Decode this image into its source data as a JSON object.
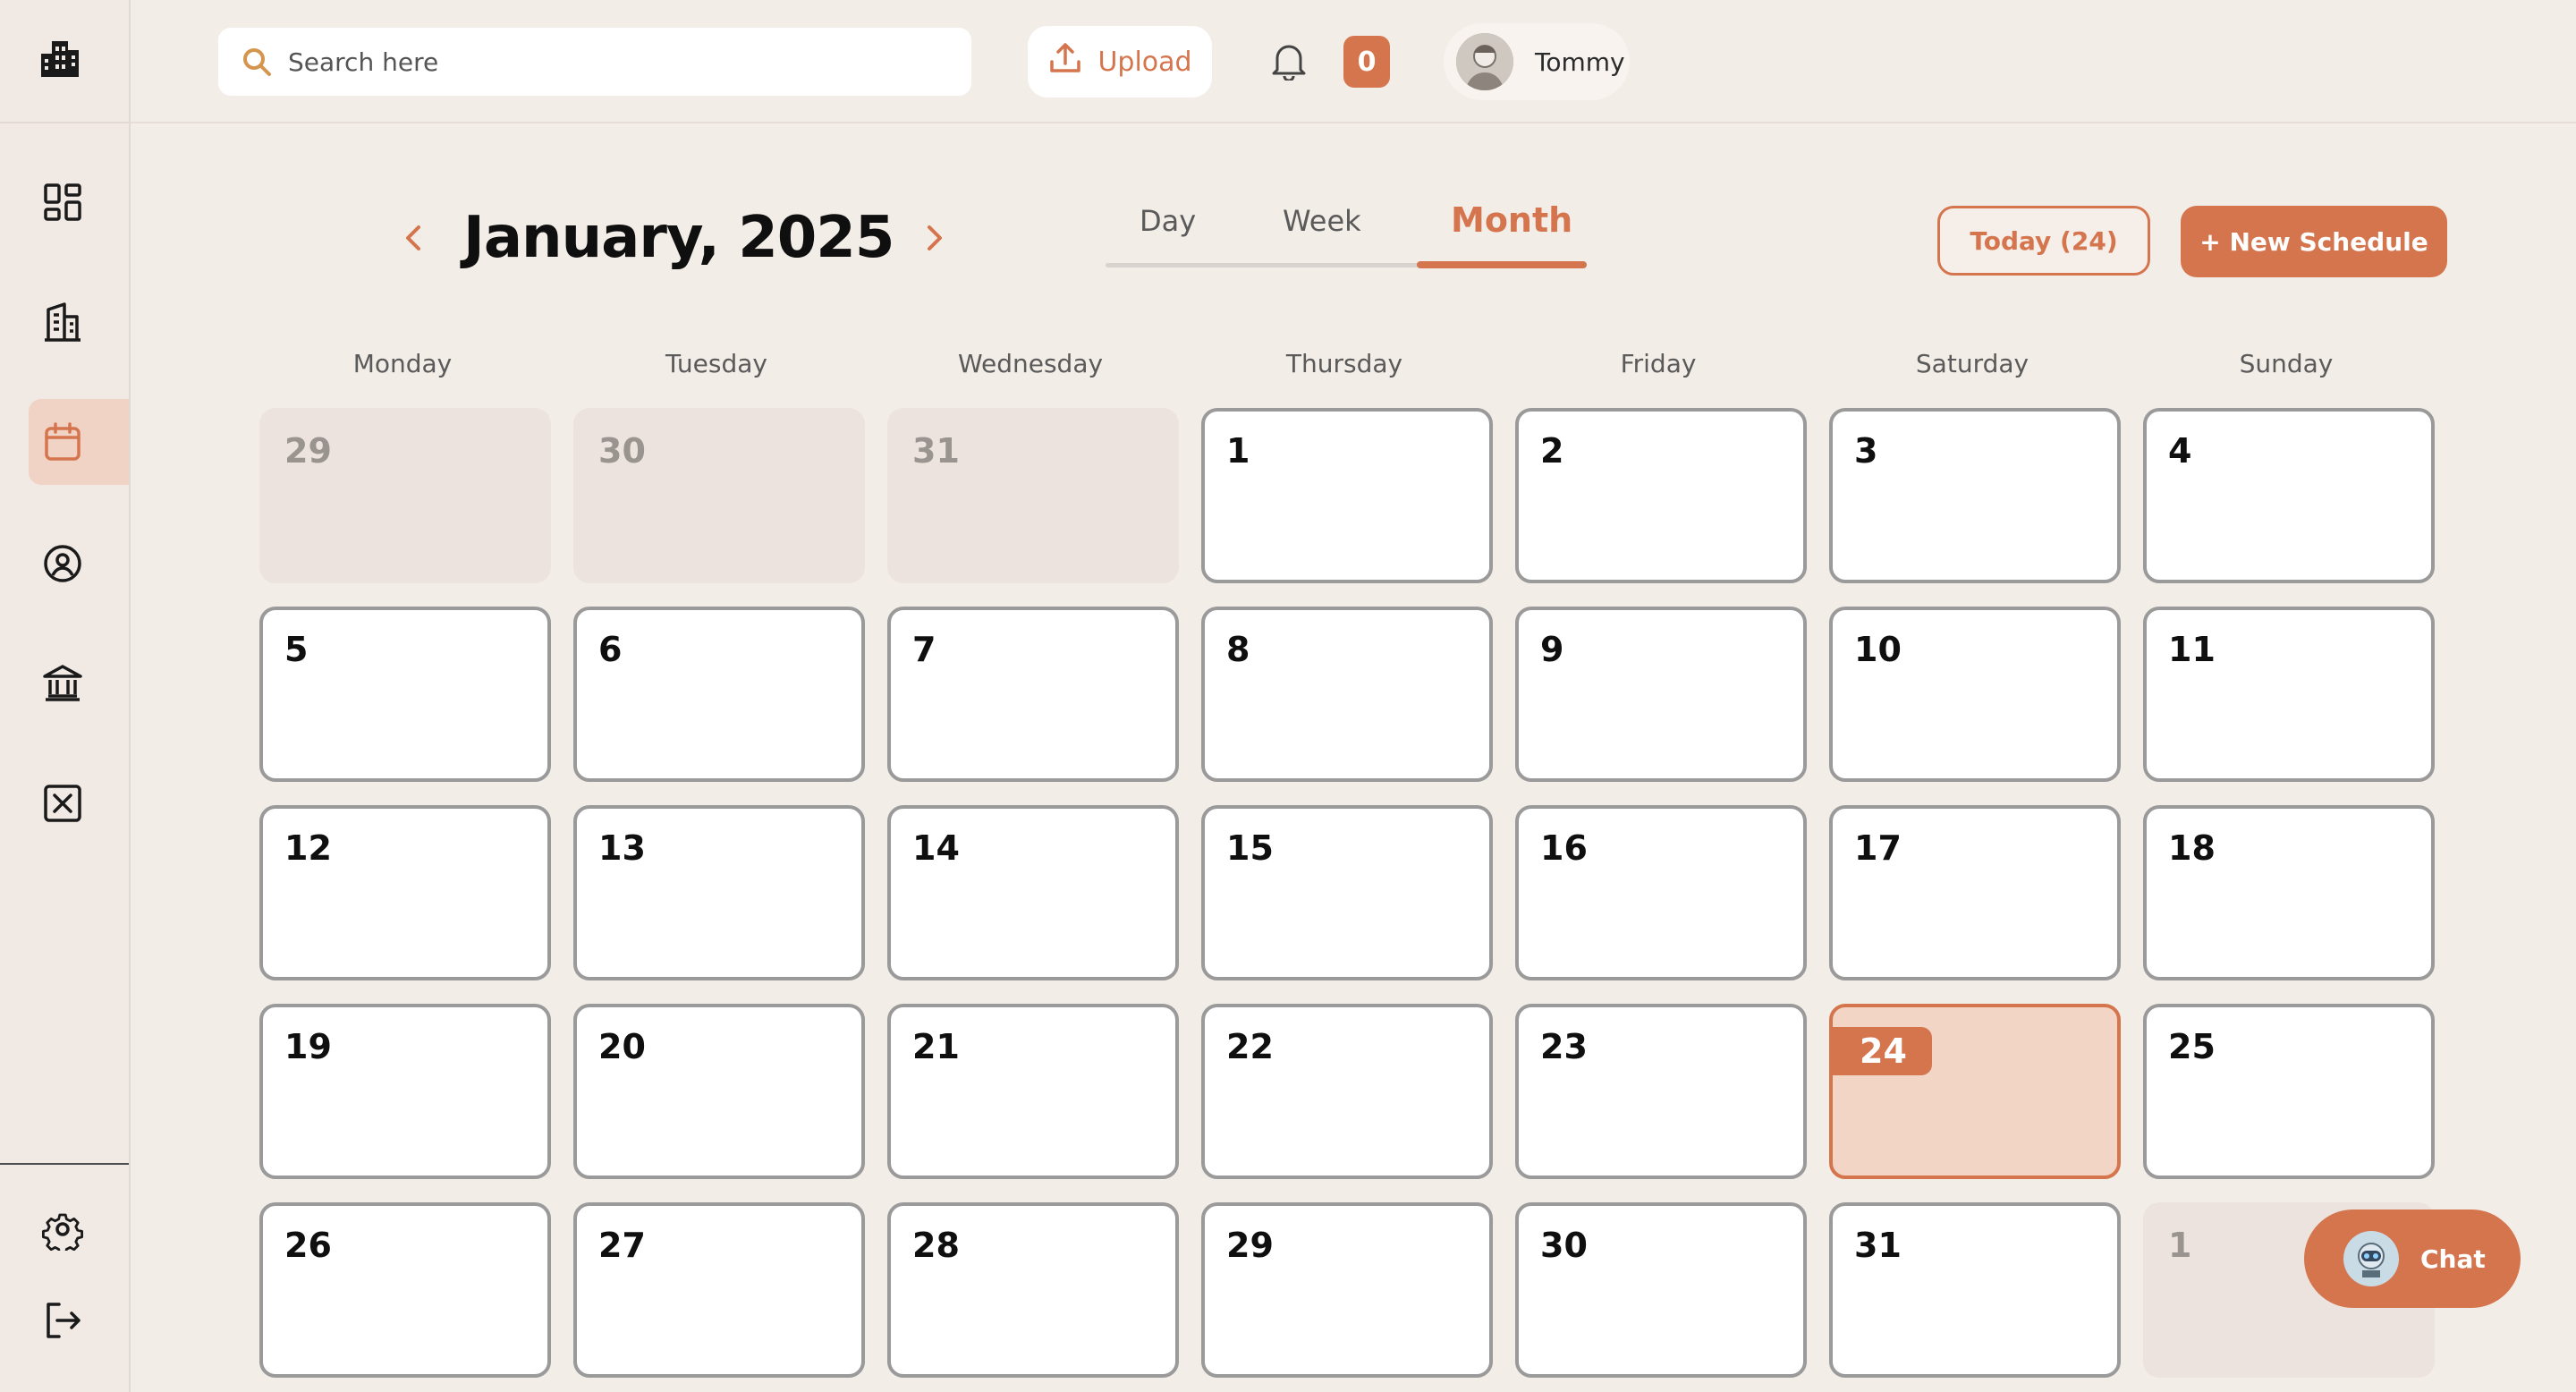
{
  "brand": {
    "accent": "#d4754e",
    "accent_light": "#f3d5c6",
    "background": "#f3ede8"
  },
  "sidebar": {
    "logo_icon": "building-icon",
    "items": [
      {
        "name": "dashboard",
        "icon": "dashboard-grid-icon",
        "active": false
      },
      {
        "name": "buildings",
        "icon": "office-building-icon",
        "active": false
      },
      {
        "name": "calendar",
        "icon": "calendar-icon",
        "active": true
      },
      {
        "name": "profile",
        "icon": "user-circle-icon",
        "active": false
      },
      {
        "name": "bank",
        "icon": "bank-icon",
        "active": false
      },
      {
        "name": "close-box",
        "icon": "x-square-icon",
        "active": false
      }
    ],
    "bottom_items": [
      {
        "name": "settings",
        "icon": "gear-icon"
      },
      {
        "name": "logout",
        "icon": "logout-icon"
      }
    ]
  },
  "topbar": {
    "search_placeholder": "Search here",
    "upload_label": "Upload",
    "notification_count": "0",
    "user_name": "Tommy"
  },
  "calendar": {
    "title": "January, 2025",
    "view_tabs": [
      "Day",
      "Week",
      "Month"
    ],
    "active_view": "Month",
    "today_button": "Today (24)",
    "new_schedule_button": "+ New Schedule",
    "weekdays": [
      "Monday",
      "Tuesday",
      "Wednesday",
      "Thursday",
      "Friday",
      "Saturday",
      "Sunday"
    ],
    "weeks": [
      [
        "29",
        "30",
        "31",
        "1",
        "2",
        "3",
        "4"
      ],
      [
        "5",
        "6",
        "7",
        "8",
        "9",
        "10",
        "11"
      ],
      [
        "12",
        "13",
        "14",
        "15",
        "16",
        "17",
        "18"
      ],
      [
        "19",
        "20",
        "21",
        "22",
        "23",
        "24",
        "25"
      ],
      [
        "26",
        "27",
        "28",
        "29",
        "30",
        "31",
        "1"
      ]
    ],
    "muted_days": [
      "0-0",
      "0-1",
      "0-2",
      "4-6"
    ],
    "today": "24"
  },
  "chat": {
    "label": "Chat"
  }
}
